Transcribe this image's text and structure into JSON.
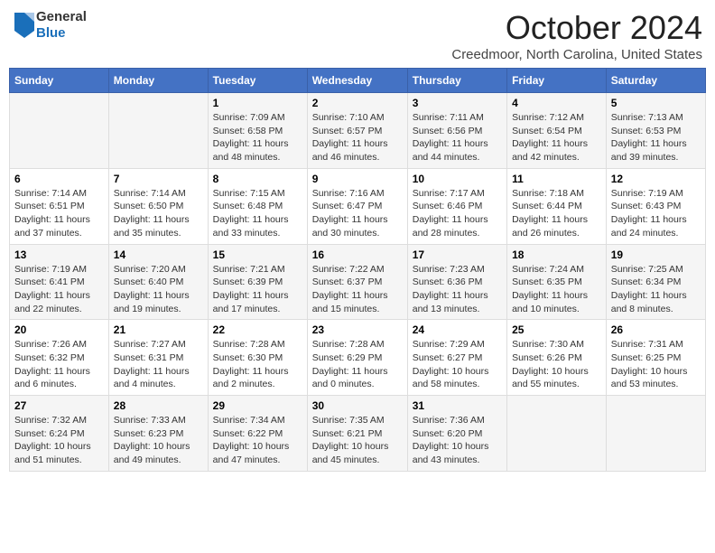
{
  "header": {
    "logo_general": "General",
    "logo_blue": "Blue",
    "month": "October 2024",
    "location": "Creedmoor, North Carolina, United States"
  },
  "days_of_week": [
    "Sunday",
    "Monday",
    "Tuesday",
    "Wednesday",
    "Thursday",
    "Friday",
    "Saturday"
  ],
  "weeks": [
    [
      {
        "day": "",
        "info": ""
      },
      {
        "day": "",
        "info": ""
      },
      {
        "day": "1",
        "info": "Sunrise: 7:09 AM\nSunset: 6:58 PM\nDaylight: 11 hours and 48 minutes."
      },
      {
        "day": "2",
        "info": "Sunrise: 7:10 AM\nSunset: 6:57 PM\nDaylight: 11 hours and 46 minutes."
      },
      {
        "day": "3",
        "info": "Sunrise: 7:11 AM\nSunset: 6:56 PM\nDaylight: 11 hours and 44 minutes."
      },
      {
        "day": "4",
        "info": "Sunrise: 7:12 AM\nSunset: 6:54 PM\nDaylight: 11 hours and 42 minutes."
      },
      {
        "day": "5",
        "info": "Sunrise: 7:13 AM\nSunset: 6:53 PM\nDaylight: 11 hours and 39 minutes."
      }
    ],
    [
      {
        "day": "6",
        "info": "Sunrise: 7:14 AM\nSunset: 6:51 PM\nDaylight: 11 hours and 37 minutes."
      },
      {
        "day": "7",
        "info": "Sunrise: 7:14 AM\nSunset: 6:50 PM\nDaylight: 11 hours and 35 minutes."
      },
      {
        "day": "8",
        "info": "Sunrise: 7:15 AM\nSunset: 6:48 PM\nDaylight: 11 hours and 33 minutes."
      },
      {
        "day": "9",
        "info": "Sunrise: 7:16 AM\nSunset: 6:47 PM\nDaylight: 11 hours and 30 minutes."
      },
      {
        "day": "10",
        "info": "Sunrise: 7:17 AM\nSunset: 6:46 PM\nDaylight: 11 hours and 28 minutes."
      },
      {
        "day": "11",
        "info": "Sunrise: 7:18 AM\nSunset: 6:44 PM\nDaylight: 11 hours and 26 minutes."
      },
      {
        "day": "12",
        "info": "Sunrise: 7:19 AM\nSunset: 6:43 PM\nDaylight: 11 hours and 24 minutes."
      }
    ],
    [
      {
        "day": "13",
        "info": "Sunrise: 7:19 AM\nSunset: 6:41 PM\nDaylight: 11 hours and 22 minutes."
      },
      {
        "day": "14",
        "info": "Sunrise: 7:20 AM\nSunset: 6:40 PM\nDaylight: 11 hours and 19 minutes."
      },
      {
        "day": "15",
        "info": "Sunrise: 7:21 AM\nSunset: 6:39 PM\nDaylight: 11 hours and 17 minutes."
      },
      {
        "day": "16",
        "info": "Sunrise: 7:22 AM\nSunset: 6:37 PM\nDaylight: 11 hours and 15 minutes."
      },
      {
        "day": "17",
        "info": "Sunrise: 7:23 AM\nSunset: 6:36 PM\nDaylight: 11 hours and 13 minutes."
      },
      {
        "day": "18",
        "info": "Sunrise: 7:24 AM\nSunset: 6:35 PM\nDaylight: 11 hours and 10 minutes."
      },
      {
        "day": "19",
        "info": "Sunrise: 7:25 AM\nSunset: 6:34 PM\nDaylight: 11 hours and 8 minutes."
      }
    ],
    [
      {
        "day": "20",
        "info": "Sunrise: 7:26 AM\nSunset: 6:32 PM\nDaylight: 11 hours and 6 minutes."
      },
      {
        "day": "21",
        "info": "Sunrise: 7:27 AM\nSunset: 6:31 PM\nDaylight: 11 hours and 4 minutes."
      },
      {
        "day": "22",
        "info": "Sunrise: 7:28 AM\nSunset: 6:30 PM\nDaylight: 11 hours and 2 minutes."
      },
      {
        "day": "23",
        "info": "Sunrise: 7:28 AM\nSunset: 6:29 PM\nDaylight: 11 hours and 0 minutes."
      },
      {
        "day": "24",
        "info": "Sunrise: 7:29 AM\nSunset: 6:27 PM\nDaylight: 10 hours and 58 minutes."
      },
      {
        "day": "25",
        "info": "Sunrise: 7:30 AM\nSunset: 6:26 PM\nDaylight: 10 hours and 55 minutes."
      },
      {
        "day": "26",
        "info": "Sunrise: 7:31 AM\nSunset: 6:25 PM\nDaylight: 10 hours and 53 minutes."
      }
    ],
    [
      {
        "day": "27",
        "info": "Sunrise: 7:32 AM\nSunset: 6:24 PM\nDaylight: 10 hours and 51 minutes."
      },
      {
        "day": "28",
        "info": "Sunrise: 7:33 AM\nSunset: 6:23 PM\nDaylight: 10 hours and 49 minutes."
      },
      {
        "day": "29",
        "info": "Sunrise: 7:34 AM\nSunset: 6:22 PM\nDaylight: 10 hours and 47 minutes."
      },
      {
        "day": "30",
        "info": "Sunrise: 7:35 AM\nSunset: 6:21 PM\nDaylight: 10 hours and 45 minutes."
      },
      {
        "day": "31",
        "info": "Sunrise: 7:36 AM\nSunset: 6:20 PM\nDaylight: 10 hours and 43 minutes."
      },
      {
        "day": "",
        "info": ""
      },
      {
        "day": "",
        "info": ""
      }
    ]
  ]
}
